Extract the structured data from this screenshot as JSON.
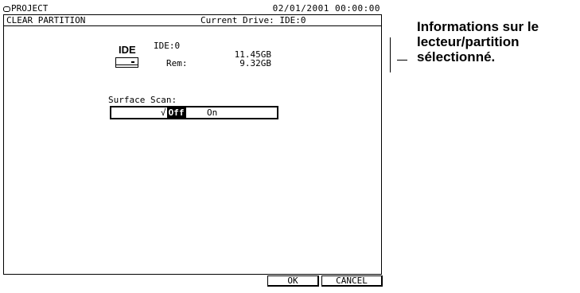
{
  "topbar": {
    "project_label": "PROJECT",
    "datetime": "02/01/2001 00:00:00"
  },
  "panel": {
    "title": "CLEAR PARTITION",
    "current_drive": "Current Drive: IDE:0"
  },
  "drive_info": {
    "type_label": "IDE",
    "drive_id": "IDE:0",
    "size": "11.45GB",
    "rem_label": "Rem:",
    "rem_value": "9.32GB"
  },
  "surface_scan": {
    "label": "Surface Scan:",
    "check_mark": "√",
    "option_off": "Off",
    "option_on": "On",
    "selected": "Off"
  },
  "buttons": {
    "ok": "OK",
    "cancel": "CANCEL"
  },
  "callout": {
    "text": "Informations sur le lecteur/partition sélectionné."
  }
}
